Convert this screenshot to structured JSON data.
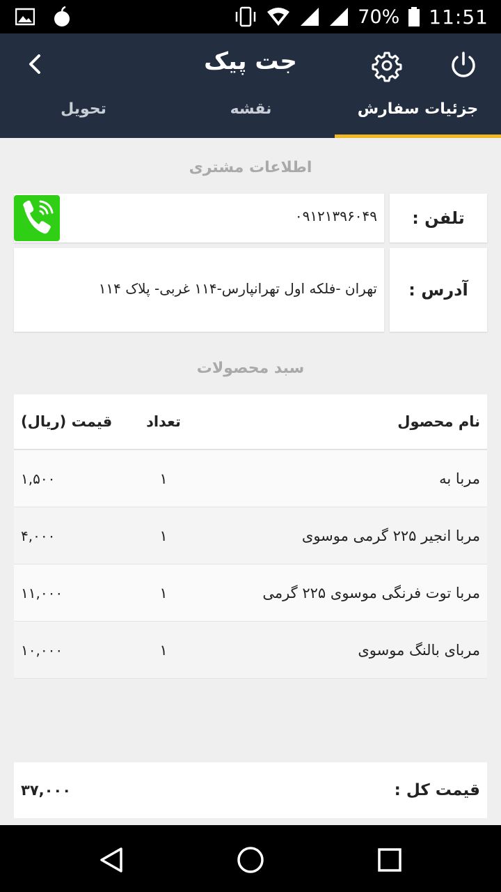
{
  "status_bar": {
    "battery": "70%",
    "time": "11:51",
    "icons": [
      "image-icon",
      "apple-icon",
      "vibrate-icon",
      "wifi-icon",
      "signal-icon",
      "signal-icon",
      "battery-icon"
    ]
  },
  "toolbar": {
    "title": "جت پیک",
    "back_icon": "chevron-left-icon",
    "settings_icon": "gear-icon",
    "power_icon": "power-icon"
  },
  "tabs": [
    {
      "label": "جزئیات سفارش",
      "active": true
    },
    {
      "label": "نقشه",
      "active": false
    },
    {
      "label": "تحویل",
      "active": false
    }
  ],
  "customer": {
    "section_title": "اطلاعات مشتری",
    "phone_label": "تلفن :",
    "phone_value": "۰۹۱۲۱۳۹۶۰۴۹",
    "call_icon": "phone-call-icon",
    "address_label": "آدرس :",
    "address_value": "تهران -فلکه اول تهرانپارس-۱۱۴ غربی- پلاک ۱۱۴"
  },
  "basket": {
    "section_title": "سبد محصولات",
    "columns": {
      "name": "نام محصول",
      "qty": "تعداد",
      "price": "قیمت (ریال)"
    },
    "rows": [
      {
        "name": "مربا به",
        "qty": "۱",
        "price": "۱,۵۰۰"
      },
      {
        "name": "مربا انجیر ۲۲۵ گرمی موسوی",
        "qty": "۱",
        "price": "۴,۰۰۰"
      },
      {
        "name": "مربا توت فرنگی موسوی ۲۲۵ گرمی",
        "qty": "۱",
        "price": "۱۱,۰۰۰"
      },
      {
        "name": "مربای بالنگ موسوی",
        "qty": "۱",
        "price": "۱۰,۰۰۰"
      }
    ]
  },
  "total": {
    "label": "قیمت کل :",
    "value": "۳۷,۰۰۰"
  },
  "colors": {
    "toolbar": "#232f40",
    "tab_indicator": "#f1b823",
    "call_button": "#2ecf15"
  },
  "nav_bar": {
    "icons": [
      "back-triangle-icon",
      "home-circle-icon",
      "recents-square-icon"
    ]
  }
}
